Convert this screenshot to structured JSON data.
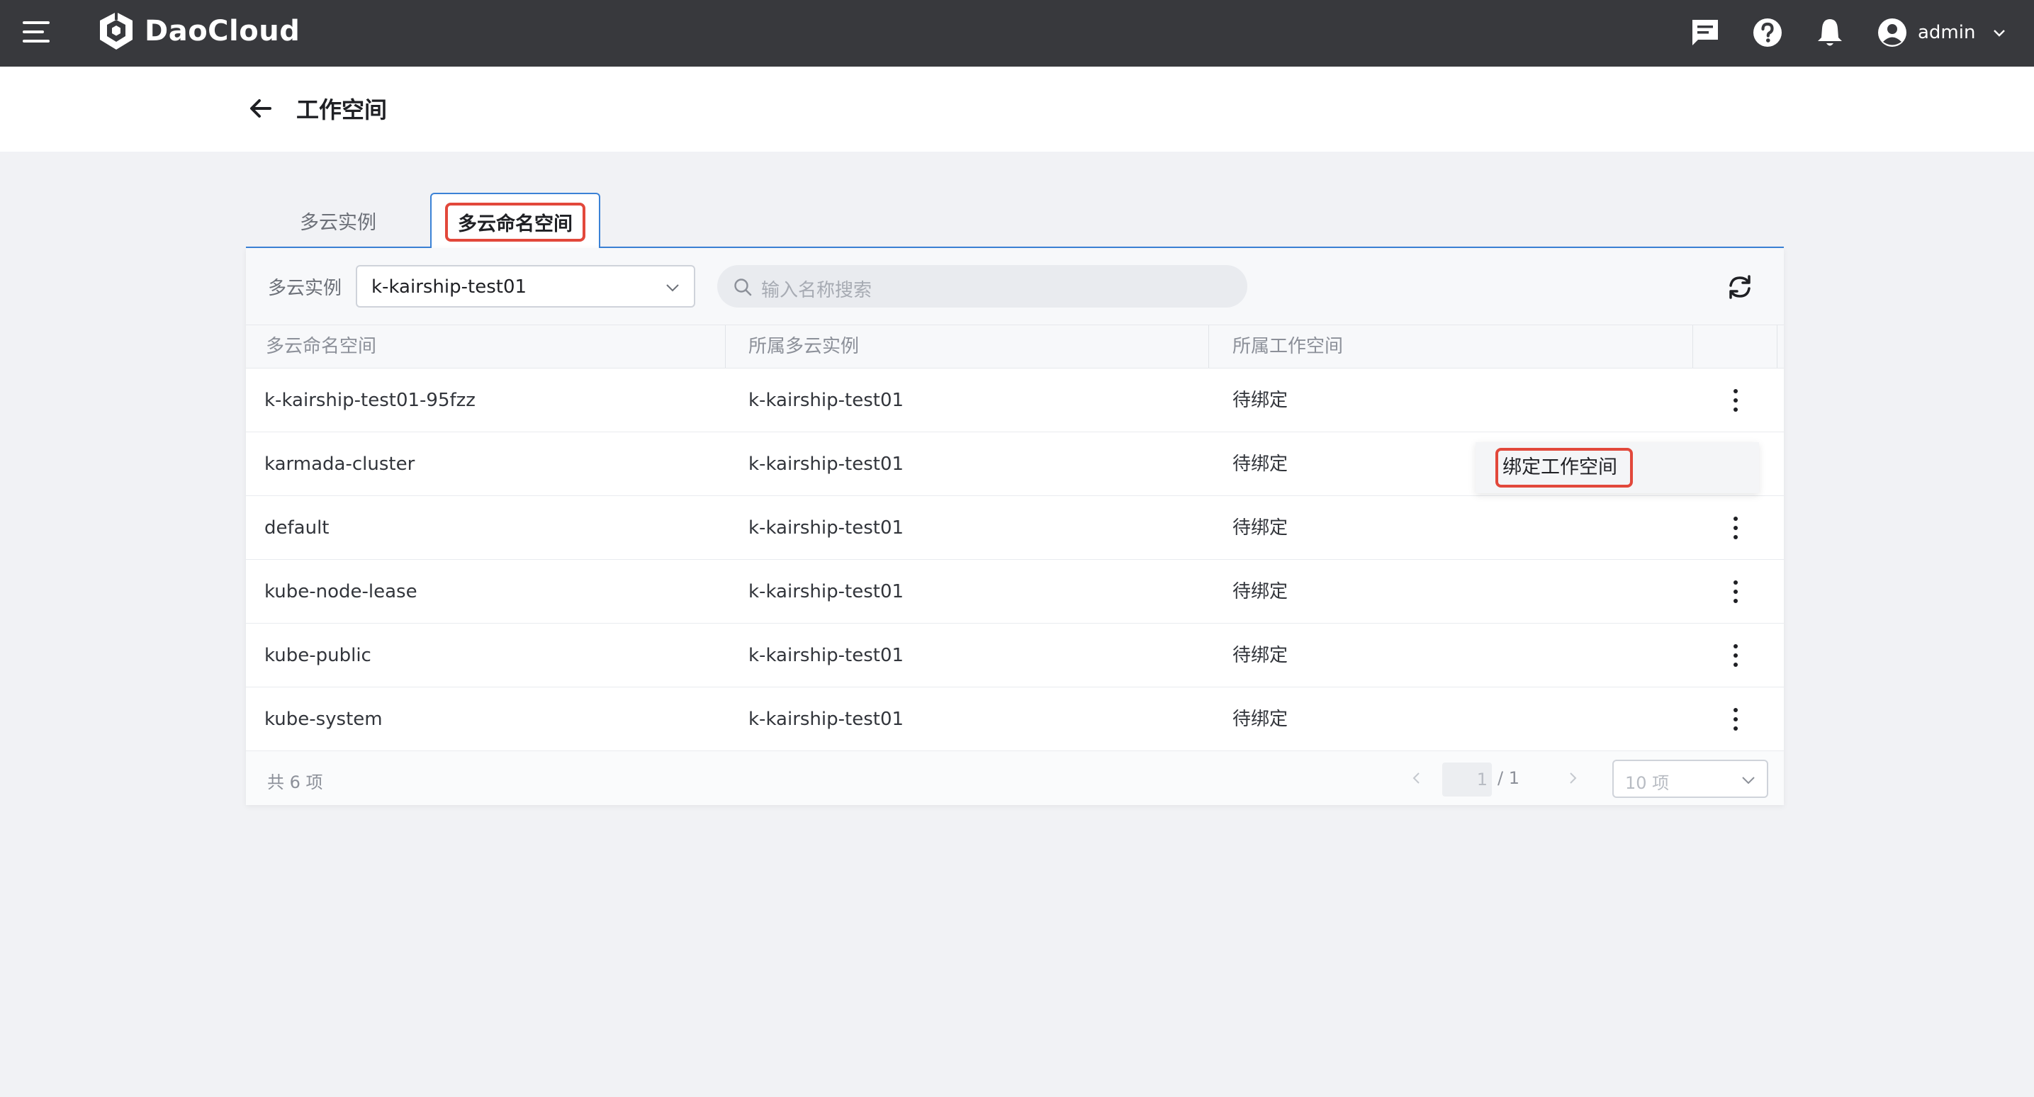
{
  "app": {
    "brand": "DaoCloud",
    "user": "admin"
  },
  "header": {
    "title": "工作空间"
  },
  "tabs": [
    {
      "label": "多云实例",
      "active": false
    },
    {
      "label": "多云命名空间",
      "active": true
    }
  ],
  "toolbar": {
    "filter_label": "多云实例",
    "filter_value": "k-kairship-test01",
    "search_placeholder": "输入名称搜索"
  },
  "table": {
    "columns": [
      "多云命名空间",
      "所属多云实例",
      "所属工作空间"
    ],
    "rows": [
      {
        "name": "k-kairship-test01-95fzz",
        "instance": "k-kairship-test01",
        "workspace": "待绑定"
      },
      {
        "name": "karmada-cluster",
        "instance": "k-kairship-test01",
        "workspace": "待绑定"
      },
      {
        "name": "default",
        "instance": "k-kairship-test01",
        "workspace": "待绑定"
      },
      {
        "name": "kube-node-lease",
        "instance": "k-kairship-test01",
        "workspace": "待绑定"
      },
      {
        "name": "kube-public",
        "instance": "k-kairship-test01",
        "workspace": "待绑定"
      },
      {
        "name": "kube-system",
        "instance": "k-kairship-test01",
        "workspace": "待绑定"
      }
    ]
  },
  "row_menu": {
    "bind_label": "绑定工作空间"
  },
  "pagination": {
    "total": "共 6 项",
    "current": "1",
    "of_total": "/ 1",
    "page_size": "10 项"
  },
  "colors": {
    "topbar": "#38393d",
    "accent": "#3b82d6",
    "highlight": "#e2483b"
  }
}
